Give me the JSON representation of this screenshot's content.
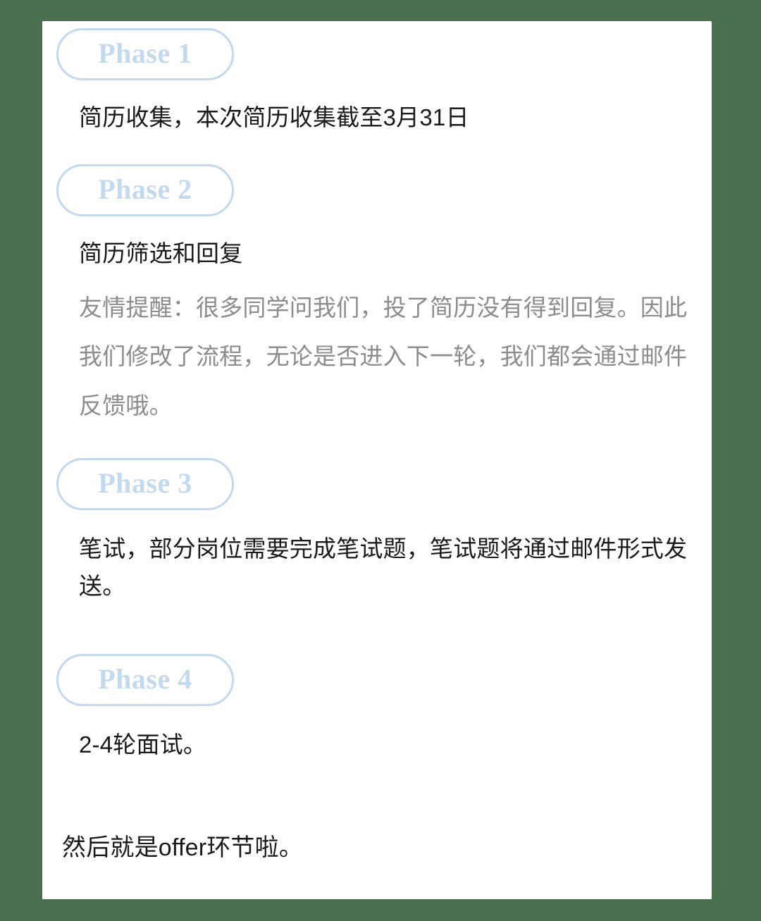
{
  "theme": {
    "page_background": "#4a7050",
    "card_background": "#ffffff",
    "badge_border_color": "#c2d8ee",
    "badge_text_color": "#c3d9ee",
    "body_text_color": "#1a1a1a",
    "note_text_color": "#8c8c8c"
  },
  "phases": [
    {
      "badge": "Phase 1",
      "body": "简历收集，本次简历收集截至3月31日",
      "note": null
    },
    {
      "badge": "Phase 2",
      "body": "简历筛选和回复",
      "note": "友情提醒：很多同学问我们，投了简历没有得到回复。因此我们修改了流程，无论是否进入下一轮，我们都会通过邮件反馈哦。"
    },
    {
      "badge": "Phase 3",
      "body": "笔试，部分岗位需要完成笔试题，笔试题将通过邮件形式发送。",
      "note": null
    },
    {
      "badge": "Phase 4",
      "body": "2-4轮面试。",
      "note": null
    }
  ],
  "closing": "然后就是offer环节啦。"
}
